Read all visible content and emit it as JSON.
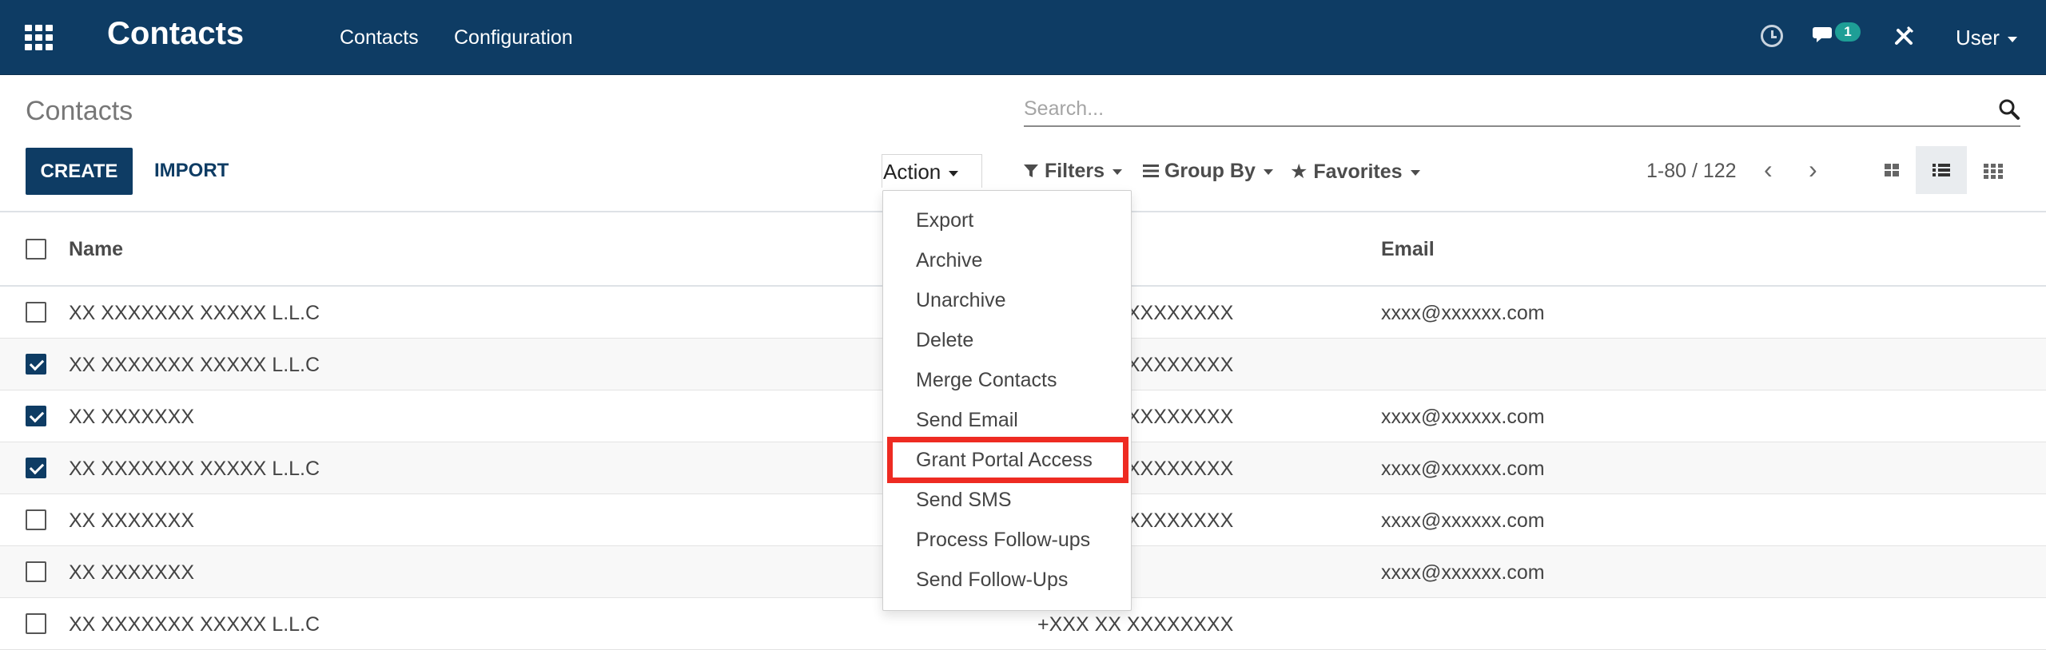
{
  "navbar": {
    "brand": "Contacts",
    "menu": [
      "Contacts",
      "Configuration"
    ],
    "chat_count": "1",
    "user": "User",
    "icons": [
      "apps-icon",
      "clock-icon",
      "chat-icon",
      "debug-tools-icon"
    ]
  },
  "control_panel": {
    "title": "Contacts",
    "search_placeholder": "Search...",
    "create_label": "CREATE",
    "import_label": "IMPORT",
    "action_label": "Action",
    "filters_label": "Filters",
    "groupby_label": "Group By",
    "favorites_label": "Favorites",
    "pager": "1-80 / 122"
  },
  "table": {
    "headers": [
      "Name",
      "Email"
    ],
    "rows": [
      {
        "name": "XX XXXXXXX XXXXX L.L.C",
        "phone": "+XXX XX XXXXXXXX",
        "email": "xxxx@xxxxxx.com",
        "checked": false
      },
      {
        "name": "XX XXXXXXX XXXXX L.L.C",
        "phone": "+XXX XX XXXXXXXX",
        "email": "",
        "checked": true
      },
      {
        "name": "XX XXXXXXX",
        "phone": "+XXX XX XXXXXXXX",
        "email": "xxxx@xxxxxx.com",
        "checked": true
      },
      {
        "name": "XX XXXXXXX XXXXX L.L.C",
        "phone": "+XXX XX XXXXXXXX",
        "email": "xxxx@xxxxxx.com",
        "checked": true
      },
      {
        "name": "XX XXXXXXX",
        "phone": "+XXX XX XXXXXXXX",
        "email": "xxxx@xxxxxx.com",
        "checked": false
      },
      {
        "name": "XX XXXXXXX",
        "phone": "",
        "email": "xxxx@xxxxxx.com",
        "checked": false
      },
      {
        "name": "XX XXXXXXX XXXXX L.L.C",
        "phone": "+XXX XX XXXXXXXX",
        "email": "",
        "checked": false
      }
    ]
  },
  "action_menu": {
    "items": [
      "Export",
      "Archive",
      "Unarchive",
      "Delete",
      "Merge Contacts",
      "Send Email",
      "Grant Portal Access",
      "Send SMS",
      "Process Follow-ups",
      "Send Follow-Ups"
    ],
    "highlighted": "Grant Portal Access",
    "highlight_color": "#ee2b22"
  },
  "colors": {
    "navbar": "#0e3c64",
    "primary": "#0e3c64",
    "badge": "#1e9e96"
  }
}
